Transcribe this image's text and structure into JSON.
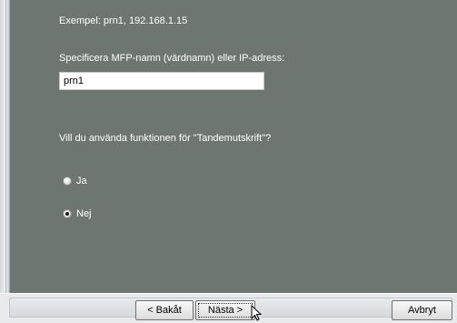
{
  "wizard": {
    "example_text": "Exempel: prn1, 192.168.1.15",
    "hostname_label": "Specificera MFP-namn (värdnamn) eller IP-adress:",
    "hostname_value": "prn1",
    "tandem_question": "Vill du använda funktionen för \"Tandemutskrift\"?",
    "options": [
      {
        "label": "Ja",
        "selected": false
      },
      {
        "label": "Nej",
        "selected": true
      }
    ]
  },
  "buttons": {
    "back_label": "< Bakåt",
    "next_label": "Nästa >",
    "cancel_label": "Avbryt"
  },
  "colors": {
    "panel_background": "#6e7672",
    "panel_text": "#ffffff"
  }
}
